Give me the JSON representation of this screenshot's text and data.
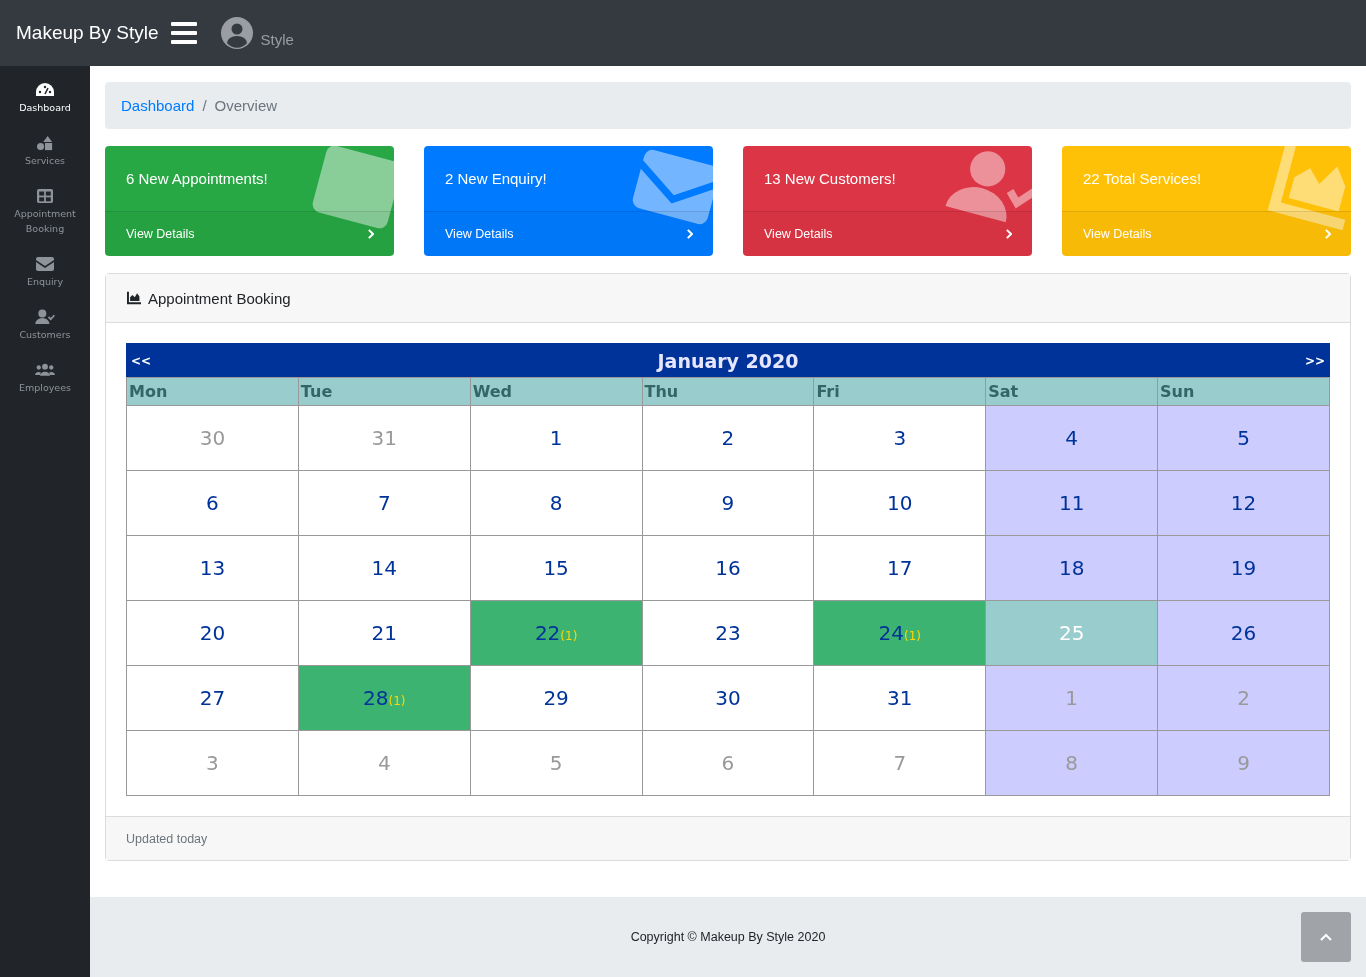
{
  "brand": "Makeup By Style",
  "user": {
    "name": "Style"
  },
  "sidebar": {
    "items": [
      {
        "label": "Dashboard",
        "kind": "gauge",
        "selected": true
      },
      {
        "label": "Services",
        "kind": "shapes",
        "selected": false
      },
      {
        "label": "Appointment Booking",
        "kind": "table",
        "selected": false
      },
      {
        "label": "Enquiry",
        "kind": "envelope",
        "selected": false
      },
      {
        "label": "Customers",
        "kind": "user-check",
        "selected": false
      },
      {
        "label": "Employees",
        "kind": "users",
        "selected": false
      }
    ]
  },
  "breadcrumb": [
    {
      "label": "Dashboard",
      "kind": "link"
    },
    {
      "label": "/",
      "kind": "separator"
    },
    {
      "label": "Overview",
      "kind": "current"
    }
  ],
  "cards": [
    {
      "title": "6 New Appointments!",
      "link": "View Details",
      "color": "#28a745",
      "kind": "table"
    },
    {
      "title": "2 New Enquiry!",
      "link": "View Details",
      "color": "#007bff",
      "kind": "envelope"
    },
    {
      "title": "13 New Customers!",
      "link": "View Details",
      "color": "#dc3545",
      "kind": "user-check"
    },
    {
      "title": "22 Total Services!",
      "link": "View Details",
      "color": "#ffc107",
      "kind": "chart"
    }
  ],
  "panel": {
    "title": "Appointment Booking",
    "footer": "Updated today",
    "calendar": {
      "prev": "<<",
      "title": "January 2020",
      "next": ">>",
      "weekdays": [
        "Mon",
        "Tue",
        "Wed",
        "Thu",
        "Fri",
        "Sat",
        "Sun"
      ],
      "weeks": [
        [
          {
            "day": "30",
            "in_month": false
          },
          {
            "day": "31",
            "in_month": false
          },
          {
            "day": "1",
            "in_month": true
          },
          {
            "day": "2",
            "in_month": true
          },
          {
            "day": "3",
            "in_month": true
          },
          {
            "day": "4",
            "in_month": true
          },
          {
            "day": "5",
            "in_month": true
          }
        ],
        [
          {
            "day": "6",
            "in_month": true
          },
          {
            "day": "7",
            "in_month": true
          },
          {
            "day": "8",
            "in_month": true
          },
          {
            "day": "9",
            "in_month": true
          },
          {
            "day": "10",
            "in_month": true
          },
          {
            "day": "11",
            "in_month": true
          },
          {
            "day": "12",
            "in_month": true
          }
        ],
        [
          {
            "day": "13",
            "in_month": true
          },
          {
            "day": "14",
            "in_month": true
          },
          {
            "day": "15",
            "in_month": true
          },
          {
            "day": "16",
            "in_month": true
          },
          {
            "day": "17",
            "in_month": true
          },
          {
            "day": "18",
            "in_month": true
          },
          {
            "day": "19",
            "in_month": true
          }
        ],
        [
          {
            "day": "20",
            "in_month": true
          },
          {
            "day": "21",
            "in_month": true
          },
          {
            "day": "22",
            "in_month": true,
            "booked": true,
            "count": "(1)"
          },
          {
            "day": "23",
            "in_month": true
          },
          {
            "day": "24",
            "in_month": true,
            "booked": true,
            "count": "(1)"
          },
          {
            "day": "25",
            "in_month": true,
            "today": true
          },
          {
            "day": "26",
            "in_month": true
          }
        ],
        [
          {
            "day": "27",
            "in_month": true
          },
          {
            "day": "28",
            "in_month": true,
            "booked": true,
            "count": "(1)"
          },
          {
            "day": "29",
            "in_month": true
          },
          {
            "day": "30",
            "in_month": true
          },
          {
            "day": "31",
            "in_month": true
          },
          {
            "day": "1",
            "in_month": false
          },
          {
            "day": "2",
            "in_month": false
          }
        ],
        [
          {
            "day": "3",
            "in_month": false
          },
          {
            "day": "4",
            "in_month": false
          },
          {
            "day": "5",
            "in_month": false
          },
          {
            "day": "6",
            "in_month": false
          },
          {
            "day": "7",
            "in_month": false
          },
          {
            "day": "8",
            "in_month": false
          },
          {
            "day": "9",
            "in_month": false
          }
        ]
      ]
    }
  },
  "footer": {
    "copyright": "Copyright © Makeup By Style 2020"
  }
}
